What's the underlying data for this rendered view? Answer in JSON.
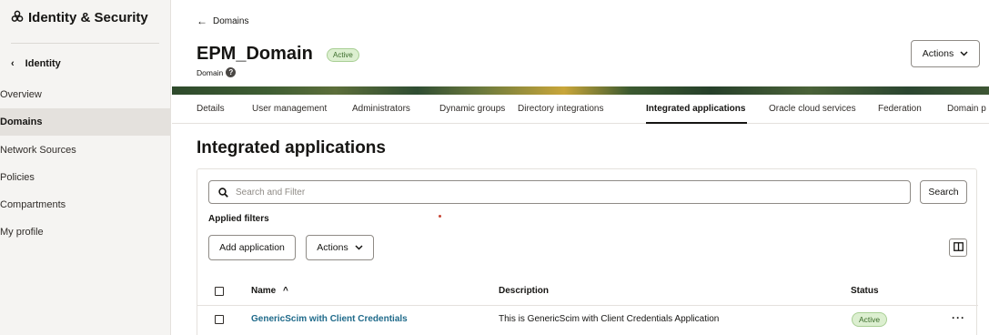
{
  "sidebar": {
    "brand": "Identity & Security",
    "back_label": "Identity",
    "items": [
      {
        "label": "Overview",
        "active": false
      },
      {
        "label": "Domains",
        "active": true
      },
      {
        "label": "Network Sources",
        "active": false
      },
      {
        "label": "Policies",
        "active": false
      },
      {
        "label": "Compartments",
        "active": false
      },
      {
        "label": "My profile",
        "active": false
      }
    ]
  },
  "header": {
    "breadcrumb": "Domains",
    "title": "EPM_Domain",
    "status_badge": "Active",
    "subtitle": "Domain",
    "help_glyph": "?",
    "actions_label": "Actions"
  },
  "tabs": [
    {
      "label": "Details",
      "active": false
    },
    {
      "label": "User management",
      "active": false
    },
    {
      "label": "Administrators",
      "active": false
    },
    {
      "label": "Dynamic groups",
      "active": false
    },
    {
      "label": "Directory integrations",
      "active": false
    },
    {
      "label": "Integrated applications",
      "active": true
    },
    {
      "label": "Oracle cloud services",
      "active": false
    },
    {
      "label": "Federation",
      "active": false
    },
    {
      "label": "Domain p",
      "active": false
    }
  ],
  "section": {
    "title": "Integrated applications",
    "search_placeholder": "Search and Filter",
    "search_button": "Search",
    "applied_filters": "Applied filters",
    "add_button": "Add application",
    "actions_button": "Actions"
  },
  "table": {
    "columns": {
      "name": "Name",
      "sort_glyph": "^",
      "description": "Description",
      "status": "Status"
    },
    "rows": [
      {
        "name": "GenericScim with Client Credentials",
        "description": "This is GenericScim with Client Credentials Application",
        "status": "Active",
        "menu": "···"
      }
    ]
  },
  "icons": {
    "brand": "identity-logo-icon",
    "back": "chevron-left-icon",
    "breadcrumb_back": "arrow-left-icon",
    "help": "help-icon",
    "dropdown": "chevron-down-icon",
    "search": "search-icon",
    "columns": "columns-icon",
    "row_menu": "kebab-icon"
  },
  "colors": {
    "link": "#1f6a8a",
    "active_badge_bg": "#dcefd0",
    "sidebar_bg": "#f5f4f2"
  }
}
